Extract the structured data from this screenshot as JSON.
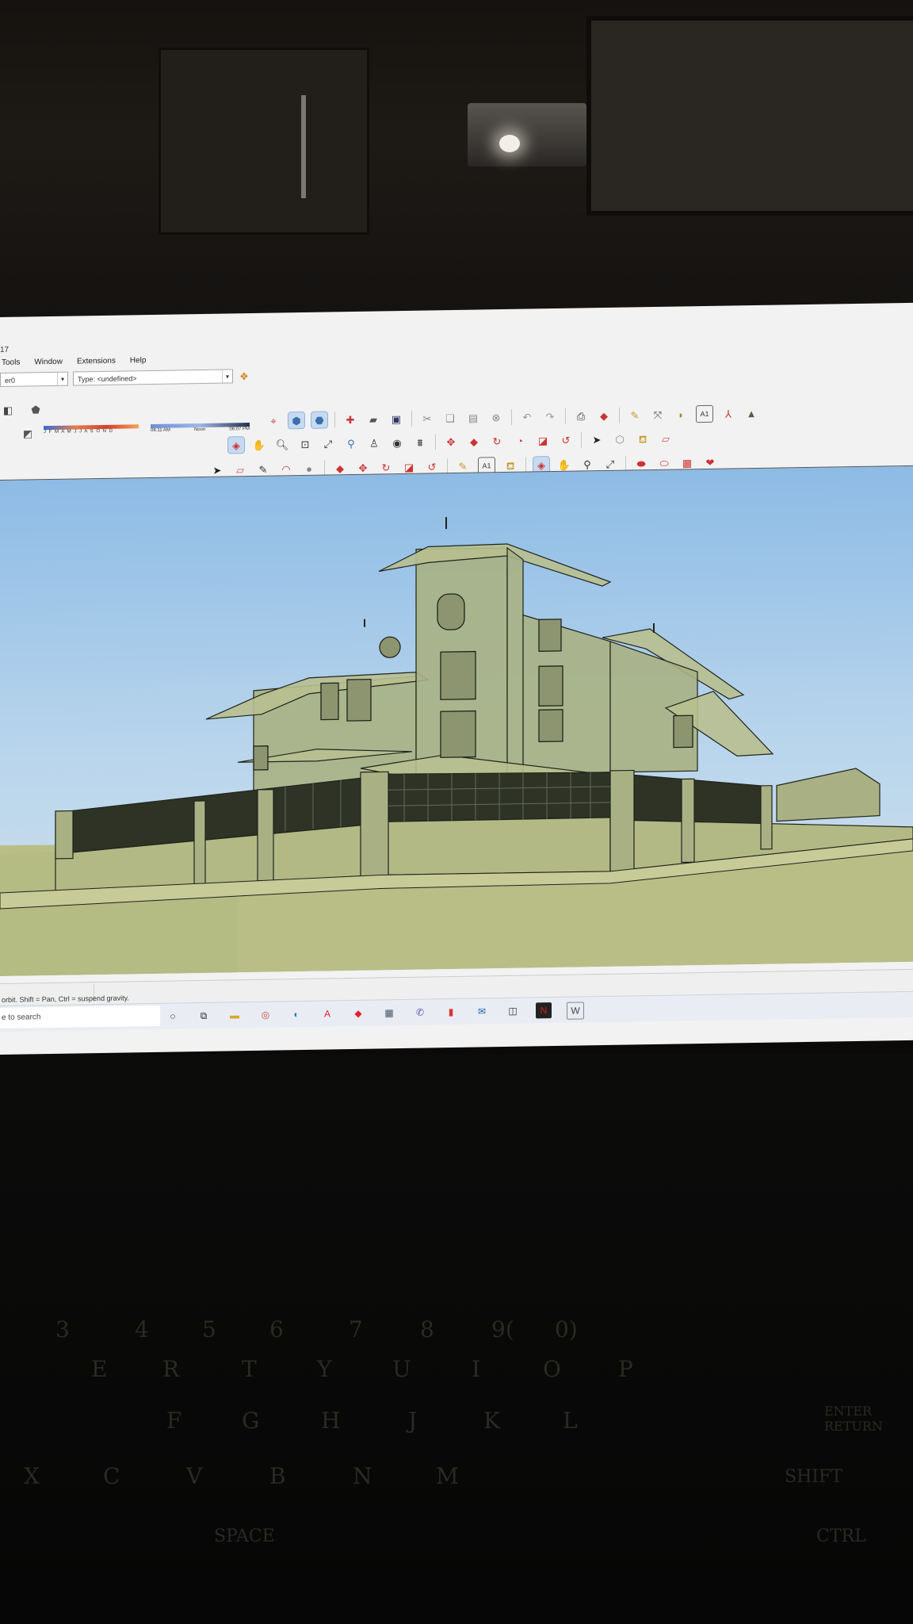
{
  "window": {
    "title_fragment": "17",
    "menus": [
      "Tools",
      "Window",
      "Extensions",
      "Help"
    ]
  },
  "layer_combo": {
    "value": "er0"
  },
  "type_combo": {
    "value": "Type: <undefined>"
  },
  "shadow_settings": {
    "months_label": "J F M A M J J A S O N D",
    "time_start": "06:11 AM",
    "time_noon": "Noon",
    "time_end": "06:07 PM"
  },
  "toolbar_icons": {
    "row1": [
      "orbit-icon",
      "select-icon",
      "paint-icon",
      "open-icon",
      "open-folder-icon",
      "save-icon",
      "cut-icon",
      "copy-icon",
      "paste-icon",
      "erase-icon",
      "undo-icon",
      "redo-icon",
      "print-icon",
      "model-info-icon",
      "tape-measure-icon",
      "dimension-icon",
      "protractor-icon",
      "text-icon",
      "axes-icon",
      "3d-text-icon"
    ],
    "row2": [
      "orbit-icon",
      "pan-icon",
      "zoom-icon",
      "zoom-window-icon",
      "zoom-extents-icon",
      "previous-view-icon",
      "position-camera-icon",
      "look-around-icon",
      "walk-icon",
      "move-icon",
      "push-pull-icon",
      "rotate-icon",
      "follow-me-icon",
      "scale-icon",
      "offset-icon",
      "select-icon",
      "make-component-icon",
      "paint-bucket-icon",
      "eraser-icon"
    ],
    "row3": [
      "select-icon",
      "eraser-icon",
      "line-icon",
      "arc-icon",
      "shape-icon",
      "push-pull-icon",
      "move-icon",
      "rotate-icon",
      "scale-icon",
      "offset-icon",
      "tape-measure-icon",
      "text-icon",
      "paint-bucket-icon",
      "orbit-icon",
      "pan-icon",
      "zoom-icon",
      "zoom-extents-icon",
      "warehouse-icon",
      "extension-warehouse-icon",
      "layout-icon",
      "ruby-icon"
    ]
  },
  "statusbar": {
    "hint": "orbit. Shift = Pan, Ctrl = suspend gravity."
  },
  "taskbar": {
    "search_placeholder": "e to search",
    "apps": [
      "cortana-icon",
      "task-view-icon",
      "file-explorer-icon",
      "chrome-icon",
      "edge-icon",
      "autocad-icon",
      "sketchup-icon",
      "calculator-icon",
      "viber-icon",
      "office-icon",
      "mail-icon",
      "store-icon",
      "netflix-icon",
      "word-icon"
    ]
  },
  "keyboard": {
    "row_numbers": [
      "3",
      "4",
      "5",
      "6",
      "7",
      "8",
      "9(",
      "0)"
    ],
    "row_top": [
      "E",
      "R",
      "T",
      "Y",
      "U",
      "I",
      "O",
      "P"
    ],
    "row_home": [
      "F",
      "G",
      "H",
      "J",
      "K",
      "L"
    ],
    "row_bottom": [
      "X",
      "C",
      "V",
      "B",
      "N",
      "M"
    ],
    "special": [
      "ENTER RETURN",
      "SHIFT",
      "SPACE",
      "CTRL"
    ]
  },
  "colors": {
    "sky": "#9cc4e8",
    "ground": "#b8be86",
    "model_tint": "#a9b184",
    "fence_dark": "#2e3326",
    "toolbar_bg": "#f2f2f2"
  }
}
